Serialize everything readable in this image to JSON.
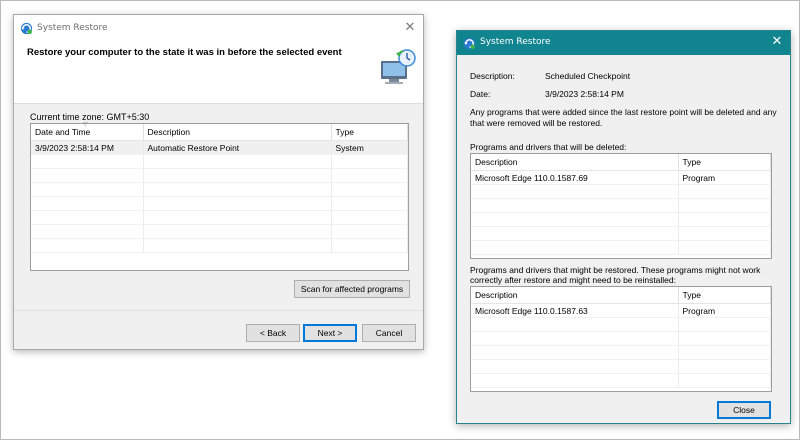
{
  "window1": {
    "title": "System Restore",
    "heading": "Restore your computer to the state it was in before the selected event",
    "timezone": "Current time zone: GMT+5:30",
    "columns": [
      "Date and Time",
      "Description",
      "Type"
    ],
    "rows": [
      {
        "date": "3/9/2023 2:58:14 PM",
        "description": "Automatic Restore Point",
        "type": "System"
      }
    ],
    "scan_label": "Scan for affected programs",
    "back_label": "< Back",
    "next_label": "Next >",
    "cancel_label": "Cancel"
  },
  "window2": {
    "title": "System Restore",
    "description_label": "Description:",
    "description_value": "Scheduled Checkpoint",
    "date_label": "Date:",
    "date_value": "3/9/2023 2:58:14 PM",
    "info_text": "Any programs that were added since the last restore point will be deleted and any that were removed will be restored.",
    "deleted_caption": "Programs and drivers that will be deleted:",
    "deleted_columns": [
      "Description",
      "Type"
    ],
    "deleted_rows": [
      {
        "description": "Microsoft Edge 110.0.1587.69",
        "type": "Program"
      }
    ],
    "restored_caption": "Programs and drivers that might be restored. These programs might not work correctly after restore and might need to be reinstalled:",
    "restored_columns": [
      "Description",
      "Type"
    ],
    "restored_rows": [
      {
        "description": "Microsoft Edge 110.0.1587.63",
        "type": "Program"
      }
    ],
    "close_label": "Close"
  },
  "colors": {
    "accent_titlebar": "#10848f",
    "default_button_border": "#0078d7"
  },
  "icons": {
    "titlebar": "system-restore-icon",
    "header": "restore-computer-icon",
    "close": "close-icon"
  }
}
